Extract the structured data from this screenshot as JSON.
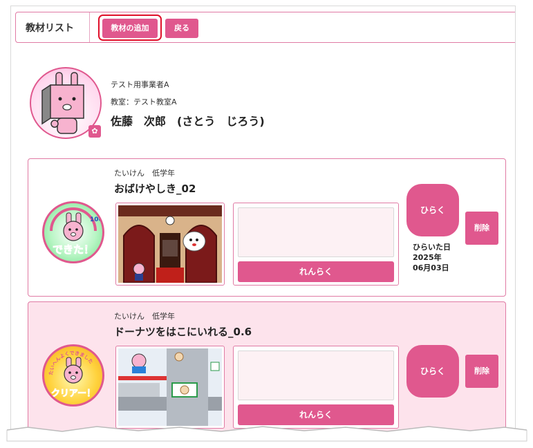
{
  "header": {
    "title": "教材リスト",
    "add_label": "教材の追加",
    "back_label": "戻る"
  },
  "owner": {
    "company": "テスト用事業者A",
    "classroom": "教室：テスト教室A",
    "name": "佐藤　次郎　(さとう　じろう)"
  },
  "materials": [
    {
      "category": "たいけん　低学年",
      "title": "おばけやしき_02",
      "badge_text": "できた！",
      "badge_score": "100",
      "contact_label": "れんらく",
      "open_label": "ひらく",
      "delete_label": "削除",
      "opened_label": "ひらいた日",
      "opened_year": "2025年",
      "opened_date": "06月03日"
    },
    {
      "category": "たいけん　低学年",
      "title": "ドーナツをはこにいれる_0.6",
      "badge_text": "クリアー！",
      "badge_top_text": "たいへんよくできました",
      "contact_label": "れんらく",
      "open_label": "ひらく",
      "delete_label": "削除"
    }
  ],
  "colors": {
    "accent": "#e0588e",
    "highlight_outline": "#e0102a",
    "card2_bg": "#fde3ec"
  }
}
